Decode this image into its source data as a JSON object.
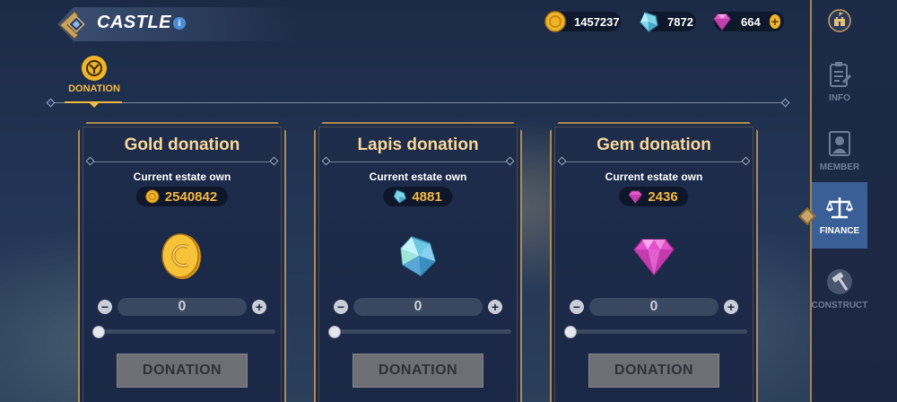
{
  "header": {
    "title": "CASTLE",
    "info_symbol": "i"
  },
  "currencies": {
    "gold": "1457237",
    "lapis": "7872",
    "gem": "664",
    "add_symbol": "+"
  },
  "tabs": [
    {
      "label": "DONATION",
      "icon": "donation-emblem-icon",
      "active": true
    }
  ],
  "cards": [
    {
      "title": "Gold donation",
      "estate_label": "Current estate own",
      "estate_value": "2540842",
      "icon": "gold-coin-icon",
      "amount": "0",
      "slider_fraction": 0,
      "button_label": "DONATION"
    },
    {
      "title": "Lapis donation",
      "estate_label": "Current estate own",
      "estate_value": "4881",
      "icon": "lapis-crystal-icon",
      "amount": "0",
      "slider_fraction": 0,
      "button_label": "DONATION"
    },
    {
      "title": "Gem donation",
      "estate_label": "Current estate own",
      "estate_value": "2436",
      "icon": "pink-gem-icon",
      "amount": "0",
      "slider_fraction": 0,
      "button_label": "DONATION"
    }
  ],
  "stepper": {
    "minus": "−",
    "plus": "+"
  },
  "sidebar": {
    "items": [
      {
        "label": "INFO",
        "icon": "clipboard-icon",
        "active": false
      },
      {
        "label": "MEMBER",
        "icon": "member-portrait-icon",
        "active": false
      },
      {
        "label": "FINANCE",
        "icon": "scales-icon",
        "active": true
      },
      {
        "label": "CONSTRUCT",
        "icon": "hammer-icon",
        "active": false
      }
    ]
  },
  "colors": {
    "accent_gold": "#f5b942",
    "title_gold": "#f7d898",
    "active_tab_bg": "#3a5f96",
    "disabled_button": "#6d6f74"
  }
}
